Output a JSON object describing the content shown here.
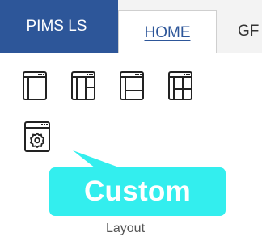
{
  "tabs": {
    "app_label": "PIMS LS",
    "home_label": "HOME",
    "next_label_partial": "GF"
  },
  "layout_group": {
    "label": "Layout",
    "buttons": [
      {
        "name": "single-pane",
        "icon": "layout-single-icon"
      },
      {
        "name": "three-column",
        "icon": "layout-three-column-icon"
      },
      {
        "name": "left-split-bottom",
        "icon": "layout-left-split-icon"
      },
      {
        "name": "grid",
        "icon": "layout-grid-icon"
      },
      {
        "name": "custom",
        "icon": "gear-icon"
      }
    ]
  },
  "callout": {
    "text": "Custom"
  },
  "colors": {
    "app_tab_bg": "#2d5699",
    "accent": "#2d5699",
    "callout_bg": "#33eeee",
    "tabstrip_bg": "#f3f3f3"
  }
}
